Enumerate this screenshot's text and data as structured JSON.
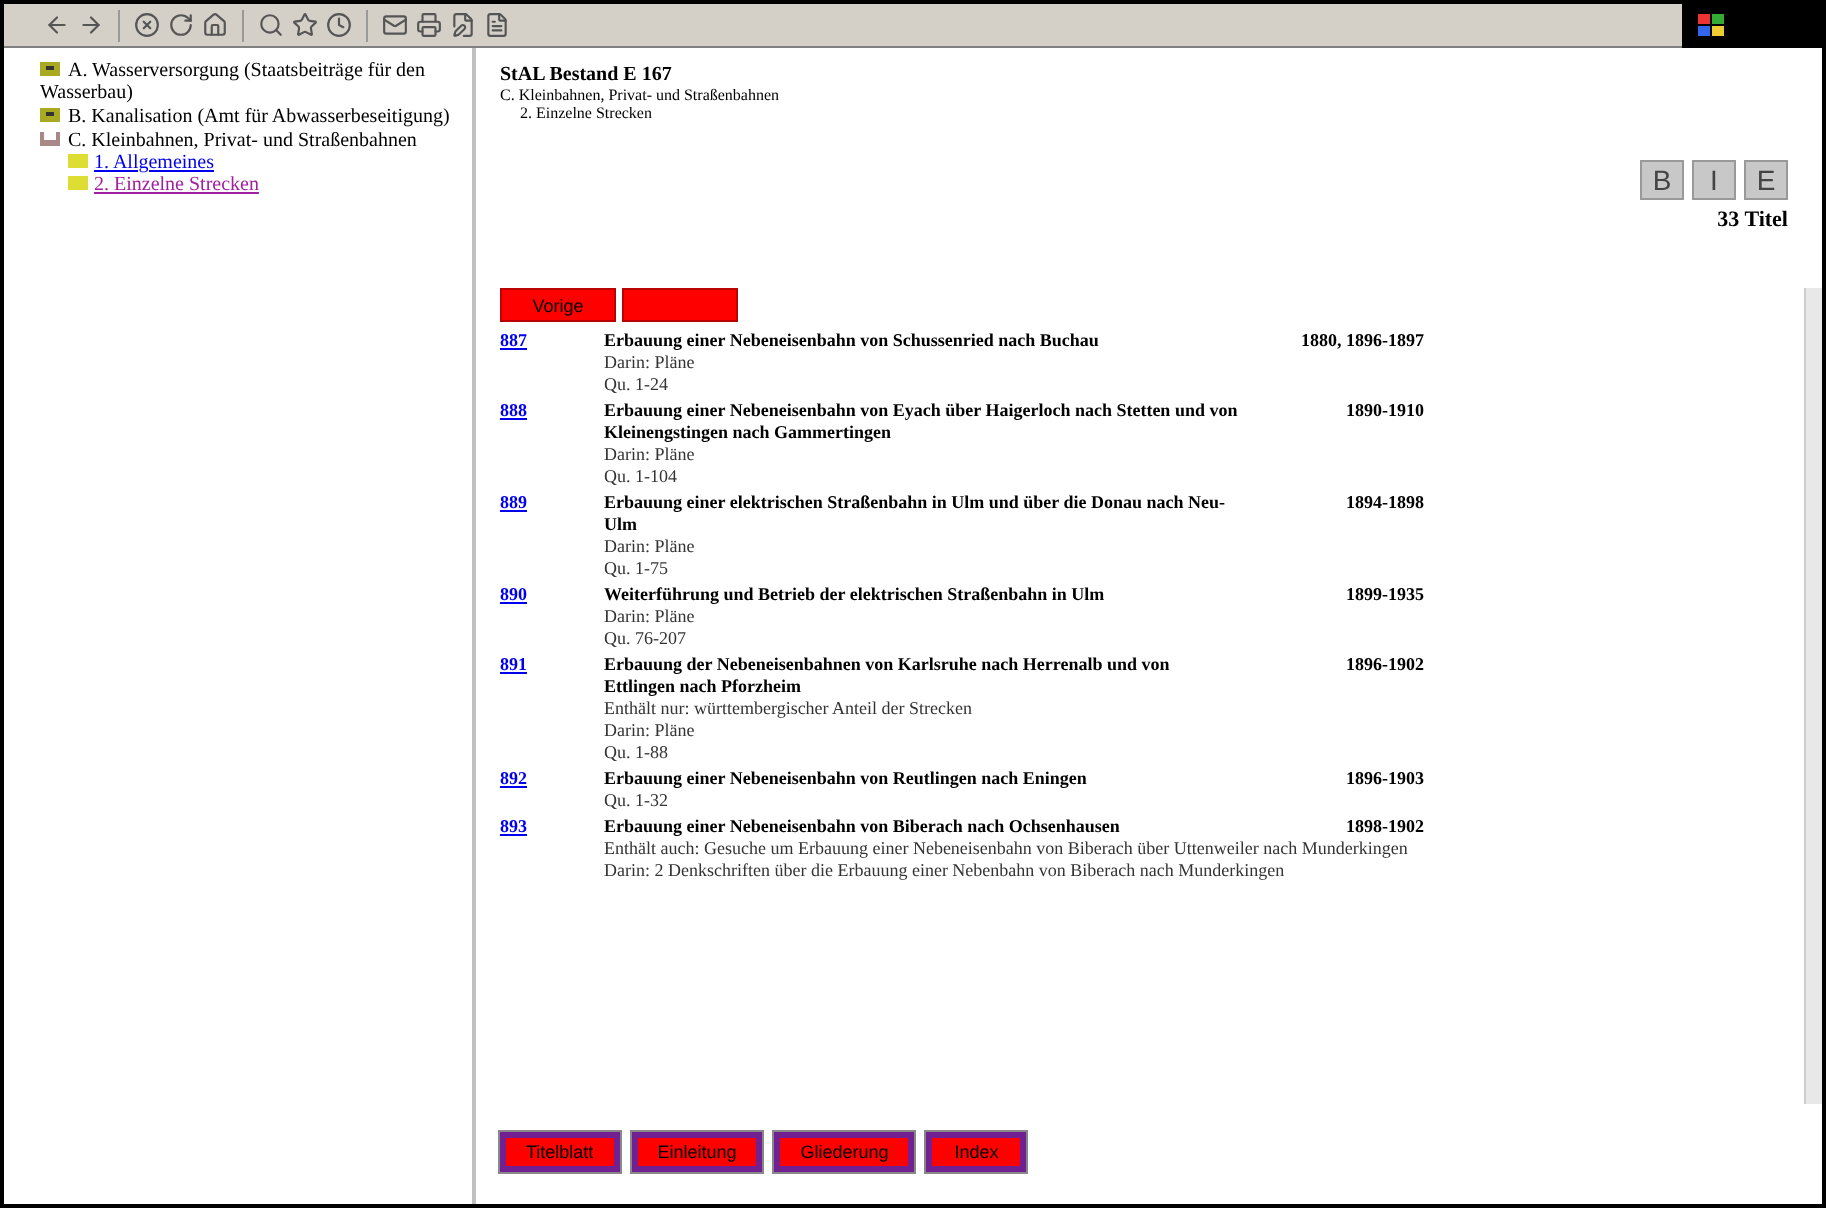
{
  "tree": [
    {
      "label": "A. Wasserversorgung (Staatsbeiträge für den Wasserbau)",
      "expanded": false
    },
    {
      "label": "B. Kanalisation (Amt für Abwasserbeseitigung)",
      "expanded": false
    },
    {
      "label": "C. Kleinbahnen, Privat- und Straßenbahnen",
      "expanded": true,
      "children": [
        {
          "label": "1. Allgemeines",
          "visited": false
        },
        {
          "label": "2. Einzelne Strecken",
          "visited": true
        }
      ]
    }
  ],
  "header": {
    "title": "StAL Bestand E 167",
    "path": [
      "C. Kleinbahnen, Privat- und Straßenbahnen",
      "2. Einzelne Strecken"
    ]
  },
  "view_buttons": [
    "B",
    "I",
    "E"
  ],
  "count": "33 Titel",
  "nav_buttons": [
    {
      "kind": "labeled",
      "label": "Vorige"
    },
    {
      "kind": "blank"
    }
  ],
  "entries": [
    {
      "number": "887",
      "title": "Erbauung einer Nebeneisenbahn von Schussenried nach Buchau",
      "date": "1880, 1896-1897",
      "notes": [
        "Darin: Pläne",
        "Qu. 1-24"
      ]
    },
    {
      "number": "888",
      "title": "Erbauung einer Nebeneisenbahn von Eyach über Haigerloch nach Stetten und von Kleinengstingen nach Gammertingen",
      "date": "1890-1910",
      "notes": [
        "Darin: Pläne",
        "Qu. 1-104"
      ]
    },
    {
      "number": "889",
      "title": "Erbauung einer elektrischen Straßenbahn in Ulm und über die Donau nach Neu-Ulm",
      "date": "1894-1898",
      "notes": [
        "Darin: Pläne",
        "Qu. 1-75"
      ]
    },
    {
      "number": "890",
      "title": "Weiterführung und Betrieb der elektrischen Straßenbahn in Ulm",
      "date": "1899-1935",
      "notes": [
        "Darin: Pläne",
        "Qu. 76-207"
      ]
    },
    {
      "number": "891",
      "title": "Erbauung der Nebeneisenbahnen von Karlsruhe nach Herrenalb und von Ettlingen nach Pforzheim",
      "date": "1896-1902",
      "notes": [
        "Enthält nur: württembergischer Anteil der Strecken",
        "Darin: Pläne",
        "Qu. 1-88"
      ]
    },
    {
      "number": "892",
      "title": "Erbauung einer Nebeneisenbahn von Reutlingen nach Eningen",
      "date": "1896-1903",
      "notes": [
        "Qu. 1-32"
      ]
    },
    {
      "number": "893",
      "title": "Erbauung einer Nebeneisenbahn von Biberach nach Ochsenhausen",
      "date": "1898-1902",
      "notes": [
        "Enthält auch: Gesuche um Erbauung einer Nebeneisenbahn von Biberach über Uttenweiler nach Munderkingen",
        "Darin: 2 Denkschriften über die Erbauung einer Nebenbahn von Biberach nach Munderkingen"
      ]
    }
  ],
  "footer_buttons": [
    "Titelblatt",
    "Einleitung",
    "Gliederung",
    "Index"
  ]
}
